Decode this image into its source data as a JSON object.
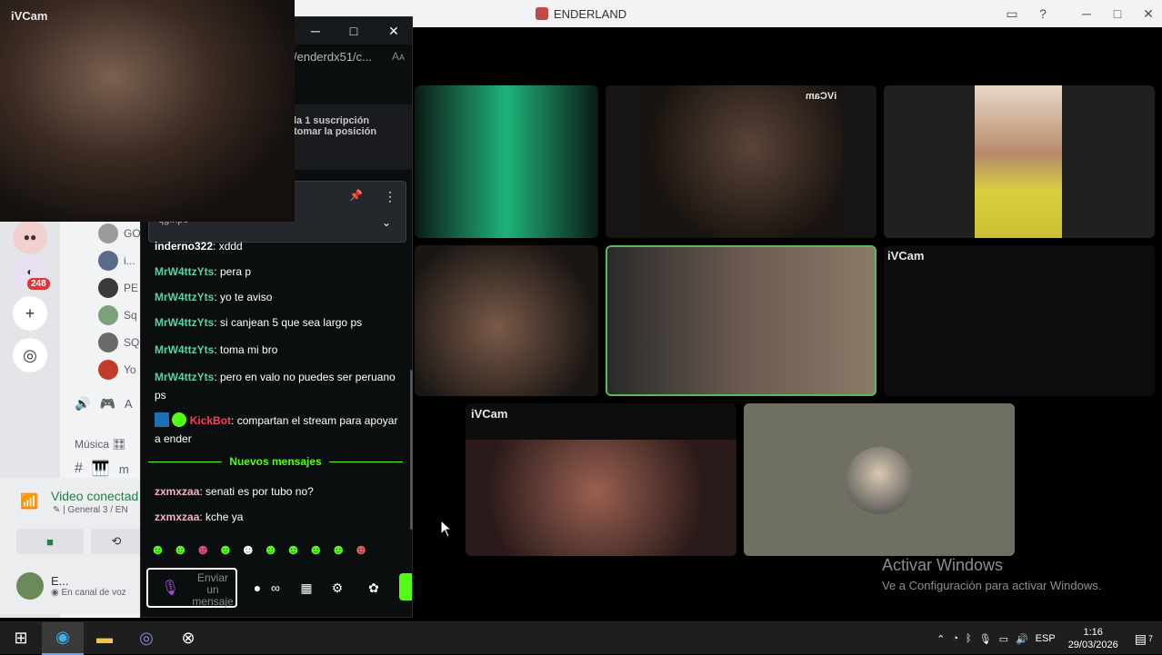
{
  "discord": {
    "window_title": "ENDERLAND",
    "server_badge": "248",
    "members": [
      "GO",
      "i...",
      "PE",
      "Sq",
      "SQ",
      "Yo"
    ],
    "category_music": "Música",
    "channel_prefix_a": "A",
    "channel_prefix_m": "m",
    "voice": {
      "status": "Video conectad",
      "channel": "General 3 / EN",
      "user_name": "E...",
      "user_status": "En canal de voz"
    }
  },
  "stage": {
    "tile_label_a": "iVCam",
    "tile_label_mirrored": "iVCam",
    "tile_label_b": "iVCam",
    "tile_label_c": "iVCam"
  },
  "ivcam_overlay": {
    "label": "iVCam"
  },
  "kick_chat": {
    "url": "/enderdx51/c...",
    "url_aa": "Aᴀ",
    "subscription_line1": "la 1 suscripción",
    "subscription_line2": "tomar la posición",
    "pinned_title": "qg...po",
    "messages": [
      {
        "user": "inderno322",
        "text": ": xddd",
        "color": "#ffffff"
      },
      {
        "user": "MrW4ttzYts",
        "text": ": pera p",
        "color": "#57d3a6"
      },
      {
        "user": "MrW4ttzYts",
        "text": ": yo te aviso",
        "color": "#57d3a6"
      },
      {
        "user": "MrW4ttzYts",
        "text": ": si canjean 5 que sea largo ps",
        "color": "#57d3a6"
      },
      {
        "user": "MrW4ttzYts",
        "text": ": toma mi bro",
        "color": "#57d3a6"
      },
      {
        "user": "MrW4ttzYts",
        "text": ": pero en valo no puedes ser peruano ps",
        "color": "#57d3a6"
      },
      {
        "user": "KickBot",
        "text": ": compartan el stream para apoyar a ender",
        "color": "#ff3b5c"
      }
    ],
    "new_messages_label": "Nuevos mensajes",
    "new_messages": [
      {
        "user": "zxmxzaa",
        "text": ": senati es por tubo no?",
        "color": "#f5b2c8"
      },
      {
        "user": "zxmxzaa",
        "text": ": kche ya",
        "color": "#f5b2c8"
      }
    ],
    "input_placeholder": "Enviar un mensaje",
    "infinity_label": "∞"
  },
  "watermark": {
    "title": "Activar Windows",
    "subtitle": "Ve a Configuración para activar Windows."
  },
  "taskbar": {
    "language": "ESP",
    "time": "1:16",
    "date": "29/03/2026",
    "notification_count": "7"
  },
  "colors": {
    "kick_green": "#53fc18",
    "discord_green": "#248046",
    "highlight_tile": "#5cb85c"
  }
}
